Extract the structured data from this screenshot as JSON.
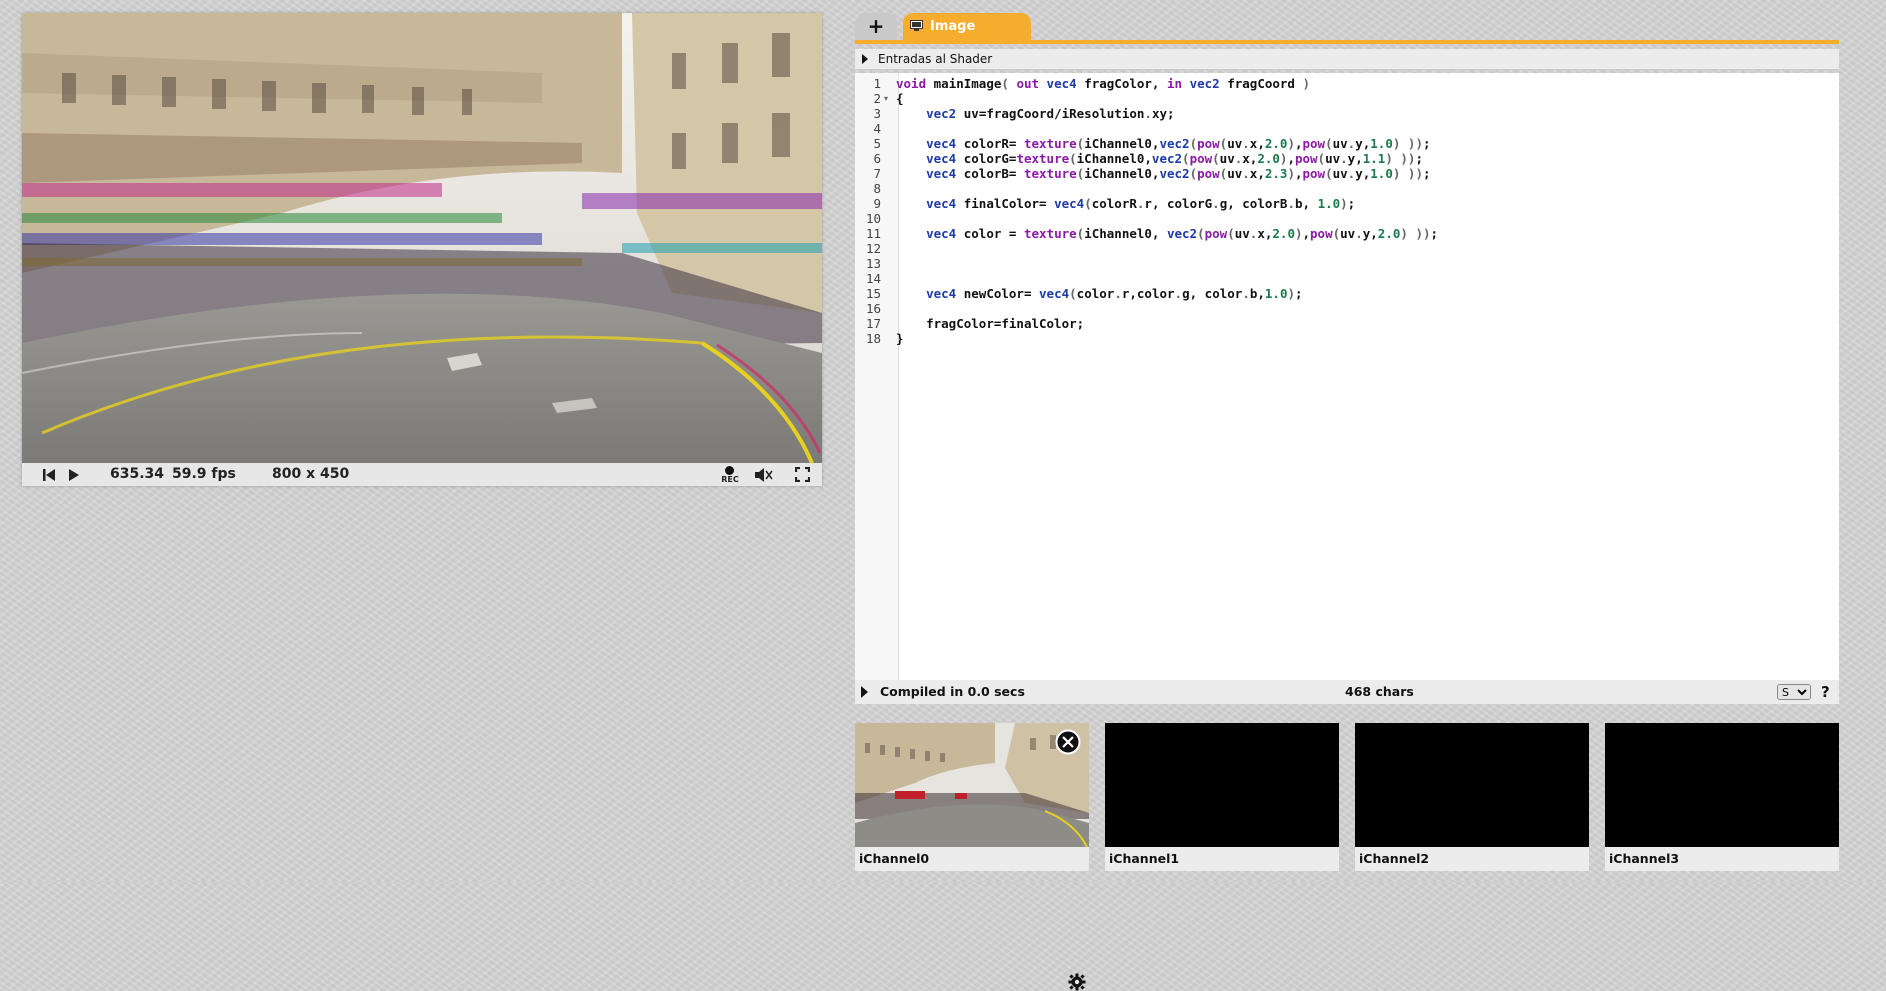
{
  "player": {
    "time": "635.34",
    "fps": "59.9 fps",
    "resolution": "800 x 450",
    "rec_label": "REC",
    "rewind_icon": "skip-back-icon",
    "play_icon": "play-icon",
    "rec_icon": "record-icon",
    "mute_icon": "speaker-mute-icon",
    "fullscreen_icon": "fullscreen-icon"
  },
  "editor": {
    "add_tab_label": "+",
    "tabs": [
      {
        "label": "Image",
        "icon": "monitor-icon"
      }
    ],
    "inputs_toggle_label": "Entradas al Shader",
    "line_numbers": [
      "1",
      "2",
      "3",
      "4",
      "5",
      "6",
      "7",
      "8",
      "9",
      "10",
      "11",
      "12",
      "13",
      "14",
      "15",
      "16",
      "17",
      "18"
    ],
    "code_lines": [
      "void mainImage( out vec4 fragColor, in vec2 fragCoord )",
      "{",
      "    vec2 uv=fragCoord/iResolution.xy;",
      "",
      "    vec4 colorR= texture(iChannel0,vec2(pow(uv.x,2.0),pow(uv.y,1.0) ));",
      "    vec4 colorG=texture(iChannel0,vec2(pow(uv.x,2.0),pow(uv.y,1.1) ));",
      "    vec4 colorB= texture(iChannel0,vec2(pow(uv.x,2.3),pow(uv.y,1.0) ));",
      "",
      "    vec4 finalColor= vec4(colorR.r, colorG.g, colorB.b, 1.0);",
      "",
      "    vec4 color = texture(iChannel0, vec2(pow(uv.x,2.0),pow(uv.y,2.0) ));",
      "",
      "",
      "",
      "    vec4 newColor= vec4(color.r,color.g, color.b,1.0);",
      "",
      "    fragColor=finalColor;",
      "}"
    ],
    "status": {
      "compile": "Compiled in 0.0 secs",
      "chars": "468 chars",
      "font_size_selected": "S",
      "help": "?"
    }
  },
  "channels": [
    {
      "label": "iChannel0",
      "has_texture": true
    },
    {
      "label": "iChannel1",
      "has_texture": false
    },
    {
      "label": "iChannel2",
      "has_texture": false
    },
    {
      "label": "iChannel3",
      "has_texture": false
    }
  ],
  "colors": {
    "accent": "#f6ad2d",
    "keyword": "#8b1aa6",
    "type": "#1d3aa8",
    "number": "#1a7a4a"
  }
}
